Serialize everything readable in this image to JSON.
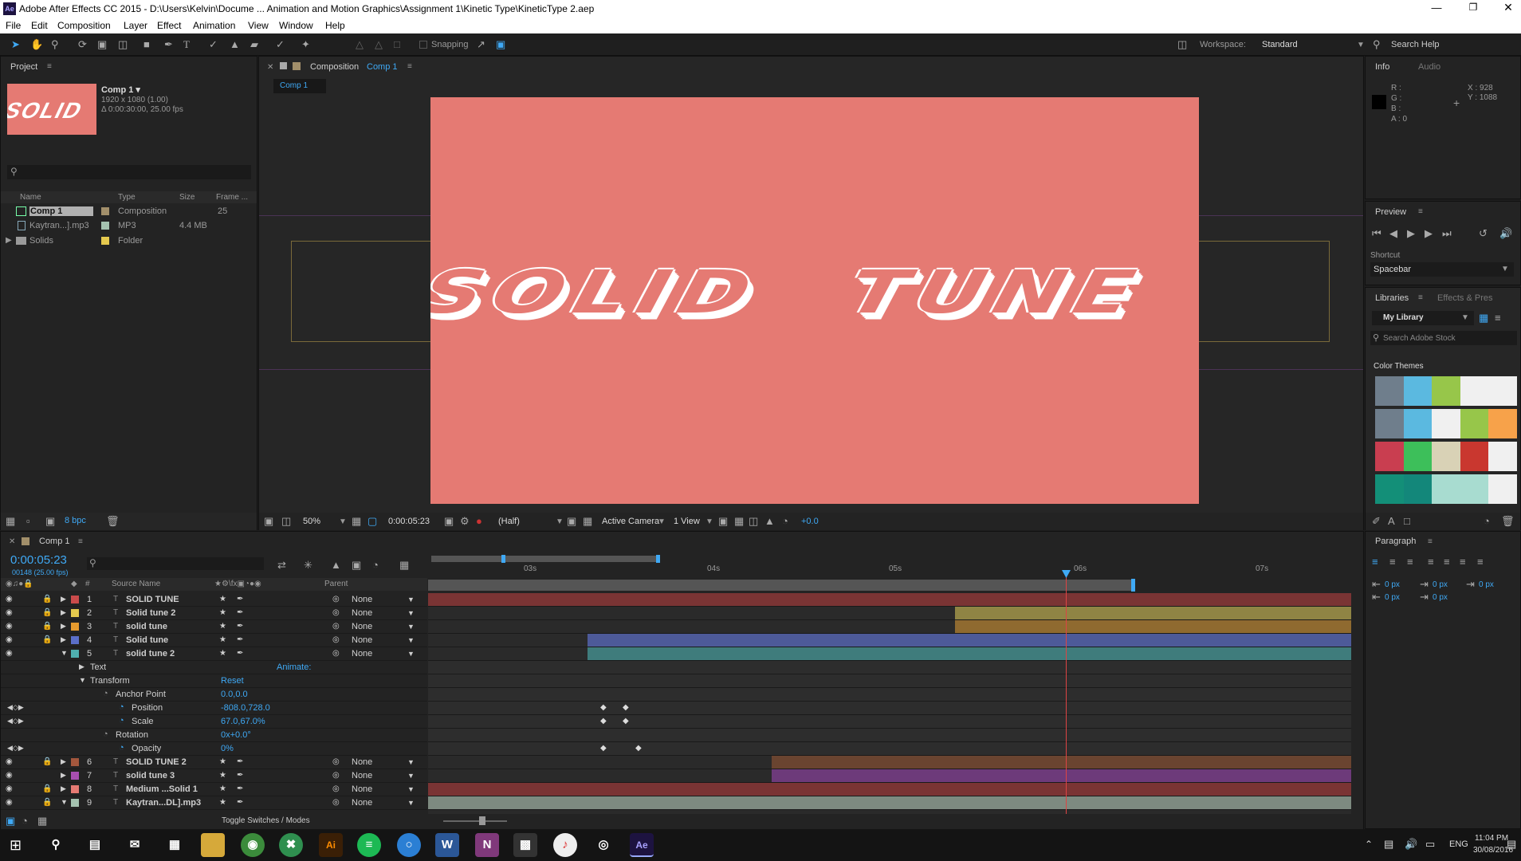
{
  "window": {
    "title": "Adobe After Effects CC 2015 - D:\\Users\\Kelvin\\Docume ... Animation and Motion Graphics\\Assignment 1\\Kinetic Type\\KineticType 2.aep",
    "app_icon": "Ae"
  },
  "menu": [
    "File",
    "Edit",
    "Composition",
    "Layer",
    "Effect",
    "Animation",
    "View",
    "Window",
    "Help"
  ],
  "toolbar": {
    "snapping": "Snapping",
    "workspace_label": "Workspace:",
    "workspace_value": "Standard",
    "search_help": "Search Help"
  },
  "project": {
    "tab": "Project",
    "comp_name": "Comp 1 ▾",
    "comp_res": "1920 x 1080 (1.00)",
    "comp_dur": "Δ 0:00:30:00, 25.00 fps",
    "columns": [
      "Name",
      "Type",
      "Size",
      "Frame ..."
    ],
    "items": [
      {
        "name": "Comp 1",
        "type": "Composition",
        "size": "",
        "frame": "25",
        "color": "#a28f6a"
      },
      {
        "name": "Kaytran...].mp3",
        "type": "MP3",
        "size": "4.4 MB",
        "frame": "",
        "color": "#a5c2b0"
      },
      {
        "name": "Solids",
        "type": "Folder",
        "size": "",
        "frame": "",
        "color": "#e5c94e"
      }
    ],
    "bpc": "8 bpc"
  },
  "composition": {
    "tab_label": "Composition",
    "tab_name": "Comp 1",
    "breadcrumb": "Comp 1",
    "canvas_color": "#e57a73",
    "text_left": "SOLID",
    "text_right": "TUNE",
    "zoom": "50%",
    "timecode": "0:00:05:23",
    "resolution": "(Half)",
    "camera": "Active Camera",
    "views": "1 View",
    "exposure": "+0.0"
  },
  "info": {
    "tab1": "Info",
    "tab2": "Audio",
    "r": "R :",
    "g": "G :",
    "b": "B :",
    "a": "A : 0",
    "x": "X : 928",
    "y": "Y : 1088"
  },
  "preview": {
    "tab": "Preview",
    "shortcut_label": "Shortcut",
    "shortcut_value": "Spacebar"
  },
  "libraries": {
    "tab1": "Libraries",
    "tab2": "Effects & Pres",
    "library": "My Library",
    "search": "Search Adobe Stock",
    "section": "Color Themes",
    "themes": [
      [
        "#6f7e8c",
        "#5bb9e0",
        "#97c64a",
        "#f0f0f0",
        "#f0f0f0"
      ],
      [
        "#6f7e8c",
        "#5bb9e0",
        "#f0f0f0",
        "#97c64a",
        "#f7a24a"
      ],
      [
        "#c93e50",
        "#3dbf5a",
        "#d9d2b6",
        "#c9372f",
        "#f0f0f0"
      ],
      [
        "#138f78",
        "#13877a",
        "#a8dcd0",
        "#a8dcd0",
        "#f0f0f0"
      ]
    ]
  },
  "paragraph": {
    "tab": "Paragraph",
    "values": [
      "0 px",
      "0 px",
      "0 px",
      "0 px",
      "0 px"
    ]
  },
  "timeline": {
    "tab": "Comp 1",
    "timecode": "0:00:05:23",
    "frame_info": "00148 (25.00 fps)",
    "col_source": "Source Name",
    "col_parent": "Parent",
    "ruler": [
      "03s",
      "04s",
      "05s",
      "06s",
      "07s"
    ],
    "layers": [
      {
        "num": "1",
        "name": "SOLID TUNE",
        "parent": "None",
        "color": "#c94b4b",
        "bar": "#7a3434",
        "start": 0,
        "end": 1
      },
      {
        "num": "2",
        "name": "Solid tune 2",
        "parent": "None",
        "color": "#e5c94e",
        "bar": "#8f8444",
        "start": 0.571,
        "end": 1
      },
      {
        "num": "3",
        "name": "solid tune",
        "parent": "None",
        "color": "#e59a2e",
        "bar": "#8f6a30",
        "start": 0.571,
        "end": 1
      },
      {
        "num": "4",
        "name": "Solid tune",
        "parent": "None",
        "color": "#5b6fc9",
        "bar": "#4d5a99",
        "start": 0.173,
        "end": 1
      },
      {
        "num": "5",
        "name": "solid tune 2",
        "parent": "None",
        "color": "#4fb0b0",
        "bar": "#3f7c7c",
        "start": 0.173,
        "end": 1
      }
    ],
    "props": {
      "text": "Text",
      "animate": "Animate:",
      "transform": "Transform",
      "reset": "Reset",
      "anchor_label": "Anchor Point",
      "anchor_value": "0.0,0.0",
      "position_label": "Position",
      "position_value": "-808.0,728.0",
      "scale_label": "Scale",
      "scale_value": "67.0,67.0%",
      "rotation_label": "Rotation",
      "rotation_value": "0x+0.0°",
      "opacity_label": "Opacity",
      "opacity_value": "0%"
    },
    "layers2": [
      {
        "num": "6",
        "name": "SOLID TUNE 2",
        "parent": "None",
        "color": "#a3573d",
        "bar": "#6a4430",
        "start": 0.372,
        "end": 1
      },
      {
        "num": "7",
        "name": "solid tune 3",
        "parent": "None",
        "color": "#a84fb0",
        "bar": "#6d3a7a",
        "start": 0.372,
        "end": 1
      },
      {
        "num": "8",
        "name": "Medium ...Solid 1",
        "parent": "None",
        "color": "#e57a73",
        "bar": "#7a3434",
        "start": 0,
        "end": 1
      },
      {
        "num": "9",
        "name": "Kaytran...DL].mp3",
        "parent": "None",
        "color": "#a5c2b0",
        "bar": "#7d8a80",
        "start": 0,
        "end": 1
      }
    ],
    "toggle": "Toggle Switches / Modes"
  },
  "taskbar": {
    "time": "11:04 PM",
    "date": "30/08/2016",
    "lang": "ENG"
  }
}
